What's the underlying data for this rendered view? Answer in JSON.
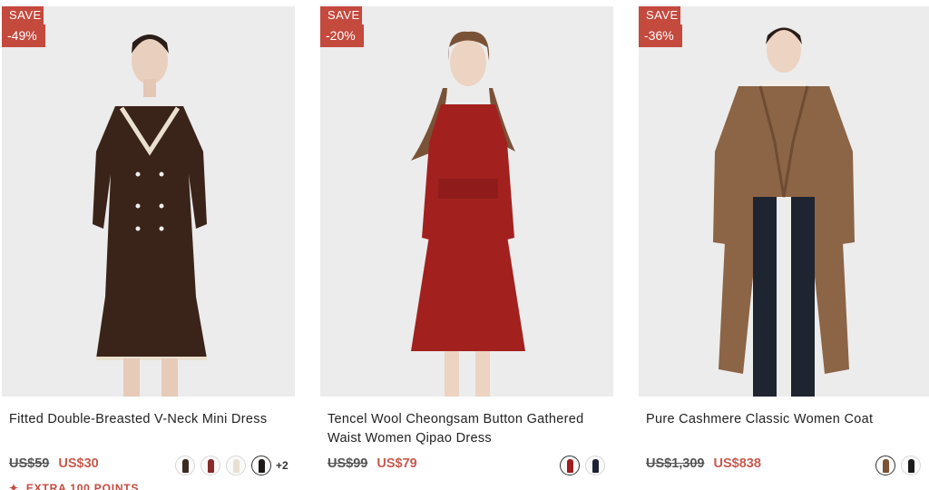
{
  "products": [
    {
      "badge_save": "SAVE",
      "badge_discount": "-49%",
      "title": "Fitted Double-Breasted V-Neck Mini Dress",
      "price_original": "US$59",
      "price_sale": "US$30",
      "swatch_colors": [
        "#3b2a20",
        "#8a2a2a",
        "#e8e0d2",
        "#1e1a18"
      ],
      "more_colors": "+2",
      "points_label": "EXTRA 100 POINTS",
      "garment_color": "#3a2419"
    },
    {
      "badge_save": "SAVE",
      "badge_discount": "-20%",
      "title": "Tencel Wool Cheongsam Button Gathered Waist Women Qipao Dress",
      "price_original": "US$99",
      "price_sale": "US$79",
      "swatch_colors": [
        "#9d1e1e",
        "#1c2233"
      ],
      "garment_color": "#a2211f"
    },
    {
      "badge_save": "SAVE",
      "badge_discount": "-36%",
      "title": "Pure Cashmere Classic Women Coat",
      "price_original": "US$1,309",
      "price_sale": "US$838",
      "swatch_colors": [
        "#7a5234",
        "#1c1c1c"
      ],
      "garment_color": "#8c6446"
    }
  ],
  "colors": {
    "badge": "#c44a3e",
    "sale_price": "#c85a4f"
  }
}
